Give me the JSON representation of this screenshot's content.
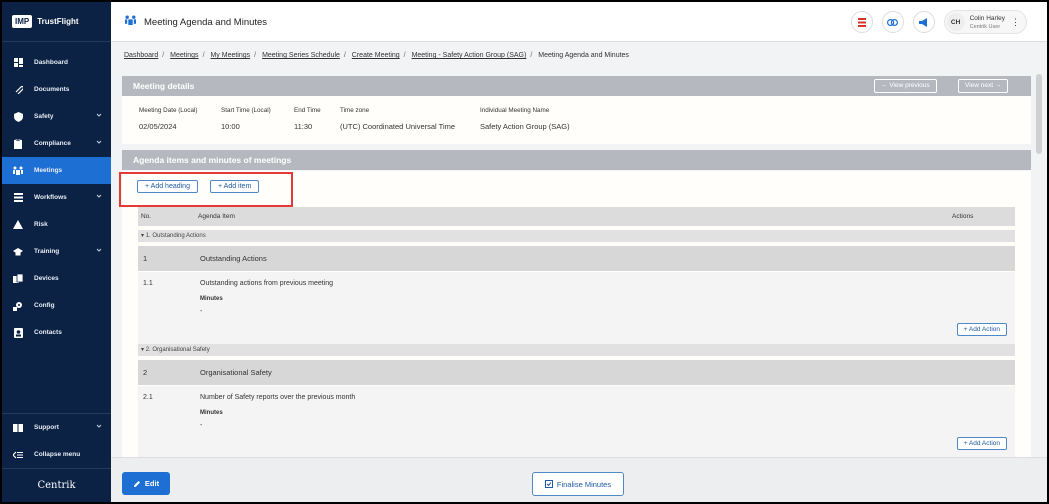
{
  "brand": {
    "logo": "IMP",
    "name": "TrustFlight",
    "footer_logo": "Centrik"
  },
  "sidebar": {
    "items": [
      {
        "label": "Dashboard",
        "icon": "dashboard-icon"
      },
      {
        "label": "Documents",
        "icon": "paperclip-icon"
      },
      {
        "label": "Safety",
        "icon": "shield-icon",
        "chevron": true
      },
      {
        "label": "Compliance",
        "icon": "clipboard-icon",
        "chevron": true
      },
      {
        "label": "Meetings",
        "icon": "meeting-icon",
        "active": true
      },
      {
        "label": "Workflows",
        "icon": "stack-icon",
        "chevron": true
      },
      {
        "label": "Risk",
        "icon": "warning-icon"
      },
      {
        "label": "Training",
        "icon": "graduation-cap-icon",
        "chevron": true
      },
      {
        "label": "Devices",
        "icon": "devices-icon"
      },
      {
        "label": "Config",
        "icon": "config-icon"
      },
      {
        "label": "Contacts",
        "icon": "contacts-icon"
      }
    ],
    "support": "Support",
    "collapse": "Collapse menu"
  },
  "header": {
    "title": "Meeting Agenda and Minutes",
    "user": {
      "initials": "CH",
      "name": "Colin Harley",
      "role": "Centrik User"
    }
  },
  "breadcrumb": {
    "links": [
      "Dashboard",
      "Meetings",
      "My Meetings",
      "Meeting Series Schedule",
      "Create Meeting",
      "Meeting - Safety Action Group (SAG)"
    ],
    "current": "Meeting Agenda and Minutes"
  },
  "details": {
    "title": "Meeting details",
    "view_previous": "View previous",
    "view_next": "View next",
    "fields": [
      {
        "label": "Meeting Date (Local)",
        "value": "02/05/2024"
      },
      {
        "label": "Start Time (Local)",
        "value": "10:00"
      },
      {
        "label": "End Time",
        "value": "11:30"
      },
      {
        "label": "Time zone",
        "value": "(UTC) Coordinated Universal Time"
      },
      {
        "label": "Individual Meeting Name",
        "value": "Safety Action Group (SAG)"
      }
    ]
  },
  "agenda": {
    "title": "Agenda items and minutes of meetings",
    "add_heading": "Add heading",
    "add_item": "Add item",
    "columns": {
      "no": "No.",
      "item": "Agenda Item",
      "actions": "Actions"
    },
    "sections": [
      {
        "label": "1. Outstanding Actions",
        "heading_no": "1",
        "heading": "Outstanding Actions",
        "item_no": "1.1",
        "item": "Outstanding actions from previous meeting",
        "minutes_label": "Minutes",
        "minutes": "-",
        "add_action": "Add Action"
      },
      {
        "label": "2. Organisational Safety",
        "heading_no": "2",
        "heading": "Organisational Safety",
        "item_no": "2.1",
        "item": "Number of Safety reports over the previous month",
        "minutes_label": "Minutes",
        "minutes": "-",
        "add_action": "Add Action"
      }
    ]
  },
  "footer": {
    "edit": "Edit",
    "finalise": "Finalise Minutes"
  }
}
